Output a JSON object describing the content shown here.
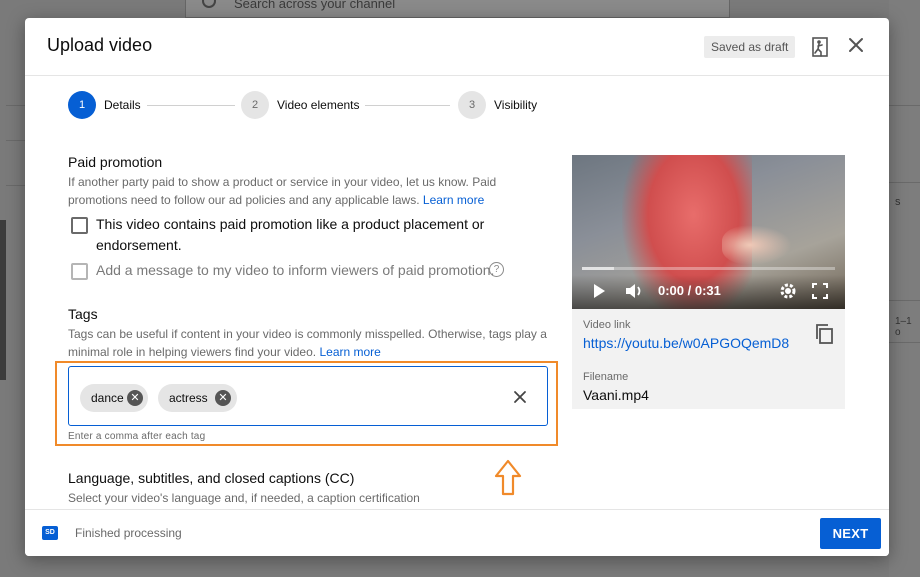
{
  "background": {
    "search_placeholder": "Search across your channel",
    "right_snippet_s": "s",
    "right_snippet_range": "1–1 o"
  },
  "dialog": {
    "title": "Upload video",
    "saved_badge": "Saved as draft",
    "close_icon": "close-icon",
    "feedback_icon": "feedback-icon"
  },
  "steps": [
    {
      "number": "1",
      "label": "Details",
      "active": true
    },
    {
      "number": "2",
      "label": "Video elements",
      "active": false
    },
    {
      "number": "3",
      "label": "Visibility",
      "active": false
    }
  ],
  "paid_promotion": {
    "title": "Paid promotion",
    "description": "If another party paid to show a product or service in your video, let us know. Paid promotions need to follow our ad policies and any applicable laws.",
    "learn_more": "Learn more",
    "checkbox_label_line1": "This video contains paid promotion like a product placement or",
    "checkbox_label_line2": "endorsement.",
    "message_checkbox_label": "Add a message to my video to inform viewers of paid promotion."
  },
  "tags": {
    "title": "Tags",
    "description": "Tags can be useful if content in your video is commonly misspelled. Otherwise, tags play a minimal role in helping viewers find your video.",
    "learn_more": "Learn more",
    "chips": [
      "dance",
      "actress"
    ],
    "hint": "Enter a comma after each tag"
  },
  "language": {
    "title": "Language, subtitles, and closed captions (CC)",
    "description": "Select your video's language and, if needed, a caption certification"
  },
  "video": {
    "time": "0:00 / 0:31",
    "link_label": "Video link",
    "link": "https://youtu.be/w0APGOQemD8",
    "filename_label": "Filename",
    "filename": "Vaani.mp4"
  },
  "footer": {
    "sd_badge": "SD",
    "status": "Finished processing",
    "next_label": "NEXT"
  },
  "colors": {
    "accent": "#065fd4",
    "highlight": "#f08a2a"
  }
}
